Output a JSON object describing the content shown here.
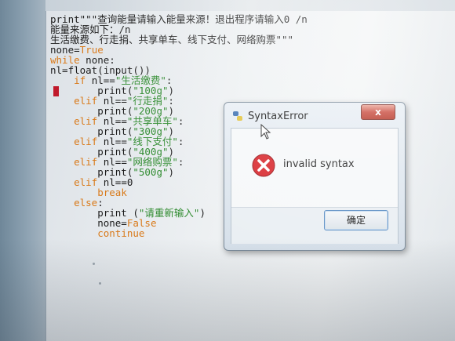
{
  "editor": {
    "lines": [
      {
        "segments": [
          {
            "t": "print\"\"\"查询能量请输入能量来源！退出程序请输入0 /n",
            "c": ""
          }
        ]
      },
      {
        "segments": [
          {
            "t": "能量来源如下：/n",
            "c": ""
          }
        ]
      },
      {
        "segments": [
          {
            "t": "生活缴费、行走捐、共享单车、线下支付、网络购票\"\"\"",
            "c": ""
          }
        ]
      },
      {
        "segments": [
          {
            "t": "none=",
            "c": ""
          },
          {
            "t": "True",
            "c": "kw"
          }
        ]
      },
      {
        "segments": [
          {
            "t": "while",
            "c": "kw"
          },
          {
            "t": " none:",
            "c": ""
          }
        ]
      },
      {
        "segments": [
          {
            "t": "nl=float(input())",
            "c": ""
          }
        ]
      },
      {
        "segments": [
          {
            "t": "    ",
            "c": ""
          },
          {
            "t": "if",
            "c": "kw"
          },
          {
            "t": " nl==",
            "c": ""
          },
          {
            "t": "\"生活缴费\"",
            "c": "st"
          },
          {
            "t": ":",
            "c": ""
          }
        ]
      },
      {
        "segments": [
          {
            "t": "        print(",
            "c": ""
          },
          {
            "t": "\"100g\"",
            "c": "st"
          },
          {
            "t": ")",
            "c": ""
          }
        ]
      },
      {
        "segments": [
          {
            "t": "    ",
            "c": ""
          },
          {
            "t": "elif",
            "c": "kw"
          },
          {
            "t": " nl==",
            "c": ""
          },
          {
            "t": "\"行走捐\"",
            "c": "st"
          },
          {
            "t": ":",
            "c": ""
          }
        ]
      },
      {
        "segments": [
          {
            "t": "        print(",
            "c": ""
          },
          {
            "t": "\"200g\"",
            "c": "st"
          },
          {
            "t": ")",
            "c": ""
          }
        ]
      },
      {
        "segments": [
          {
            "t": "    ",
            "c": ""
          },
          {
            "t": "elif",
            "c": "kw"
          },
          {
            "t": " nl==",
            "c": ""
          },
          {
            "t": "\"共享单车\"",
            "c": "st"
          },
          {
            "t": ":",
            "c": ""
          }
        ]
      },
      {
        "segments": [
          {
            "t": "        print(",
            "c": ""
          },
          {
            "t": "\"300g\"",
            "c": "st"
          },
          {
            "t": ")",
            "c": ""
          }
        ]
      },
      {
        "segments": [
          {
            "t": "    ",
            "c": ""
          },
          {
            "t": "elif",
            "c": "kw"
          },
          {
            "t": " nl==",
            "c": ""
          },
          {
            "t": "\"线下支付\"",
            "c": "st"
          },
          {
            "t": ":",
            "c": ""
          }
        ]
      },
      {
        "segments": [
          {
            "t": "        print(",
            "c": ""
          },
          {
            "t": "\"400g\"",
            "c": "st"
          },
          {
            "t": ")",
            "c": ""
          }
        ]
      },
      {
        "segments": [
          {
            "t": "    ",
            "c": ""
          },
          {
            "t": "elif",
            "c": "kw"
          },
          {
            "t": " nl==",
            "c": ""
          },
          {
            "t": "\"网络购票\"",
            "c": "st"
          },
          {
            "t": ":",
            "c": ""
          }
        ]
      },
      {
        "segments": [
          {
            "t": "        print(",
            "c": ""
          },
          {
            "t": "\"500g\"",
            "c": "st"
          },
          {
            "t": ")",
            "c": ""
          }
        ]
      },
      {
        "segments": [
          {
            "t": "    ",
            "c": ""
          },
          {
            "t": "elif",
            "c": "kw"
          },
          {
            "t": " nl==0",
            "c": ""
          }
        ]
      },
      {
        "segments": [
          {
            "t": "        ",
            "c": ""
          },
          {
            "t": "break",
            "c": "kw"
          }
        ]
      },
      {
        "segments": [
          {
            "t": "    ",
            "c": ""
          },
          {
            "t": "else",
            "c": "kw"
          },
          {
            "t": ":",
            "c": ""
          }
        ]
      },
      {
        "segments": [
          {
            "t": "        print (",
            "c": ""
          },
          {
            "t": "\"请重新输入\"",
            "c": "st"
          },
          {
            "t": ")",
            "c": ""
          }
        ]
      },
      {
        "segments": [
          {
            "t": "        none=",
            "c": ""
          },
          {
            "t": "False",
            "c": "kw"
          }
        ]
      },
      {
        "segments": [
          {
            "t": "        ",
            "c": ""
          },
          {
            "t": "continue",
            "c": "kw"
          }
        ]
      }
    ]
  },
  "dialog": {
    "title": "SyntaxError",
    "close_label": "x",
    "message": "invalid syntax",
    "ok_label": "确定"
  },
  "icons": {
    "title": "python-icon",
    "error": "error-icon",
    "pointer": "mouse-pointer-icon"
  },
  "colors": {
    "keyword": "#d97a1a",
    "string": "#2d8a2d",
    "error_red": "#d8262b",
    "close_red": "#c8473a"
  }
}
